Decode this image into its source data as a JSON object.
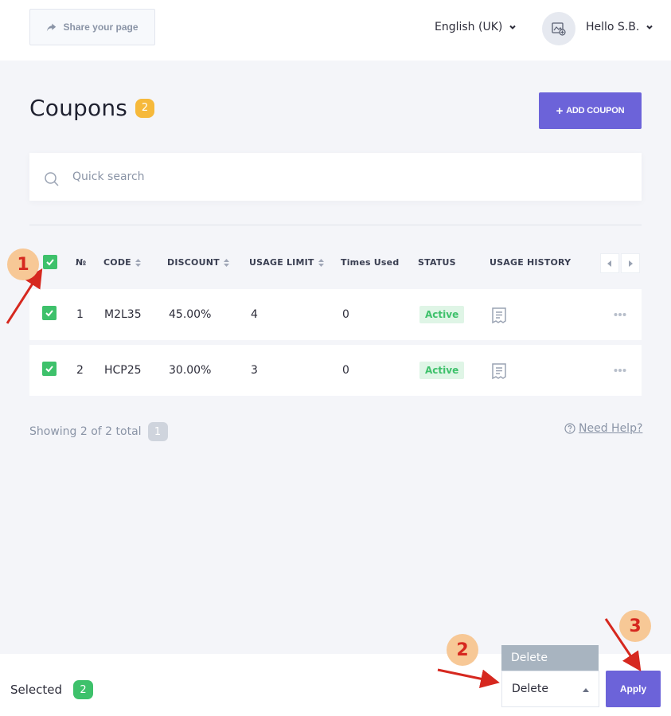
{
  "header": {
    "share_label": "Share your page",
    "language_label": "English (UK)",
    "greeting": "Hello S.B."
  },
  "page": {
    "title": "Coupons",
    "count": "2",
    "add_button_label": "ADD COUPON"
  },
  "search": {
    "placeholder": "Quick search"
  },
  "table": {
    "columns": {
      "number": "№",
      "code": "CODE",
      "discount": "DISCOUNT",
      "usage_limit": "USAGE LIMIT",
      "times_used": "Times Used",
      "status": "STATUS",
      "usage_history": "USAGE HISTORY"
    },
    "rows": [
      {
        "number": "1",
        "code": "M2L35",
        "discount": "45.00%",
        "usage_limit": "4",
        "times_used": "0",
        "status": "Active"
      },
      {
        "number": "2",
        "code": "HCP25",
        "discount": "30.00%",
        "usage_limit": "3",
        "times_used": "0",
        "status": "Active"
      }
    ]
  },
  "footer": {
    "showing_text": "Showing 2 of 2 total",
    "page_number": "1",
    "help_label": "Need Help?"
  },
  "bulk_bar": {
    "selected_label": "Selected",
    "selected_count": "2",
    "dropdown_option": "Delete",
    "selected_action": "Delete",
    "apply_label": "Apply"
  },
  "annotations": [
    "1",
    "2",
    "3"
  ],
  "colors": {
    "accent": "#6c63d9",
    "success": "#3ec16b",
    "count_badge": "#f6b93b",
    "annotation_red": "#d6281f",
    "annotation_fill": "#f7c896"
  }
}
